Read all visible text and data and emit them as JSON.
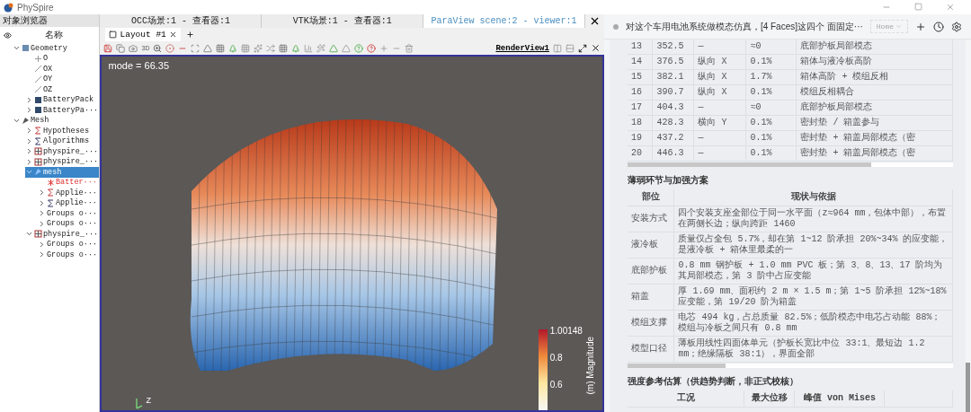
{
  "window": {
    "title": "PhySpire"
  },
  "browser": {
    "title": "对象浏览器",
    "column": "名称",
    "tree": [
      {
        "label": "Geometry",
        "kind": "geometry",
        "expanded": true,
        "selected": false,
        "children": [
          {
            "label": "O",
            "kind": "point",
            "selected": false
          },
          {
            "label": "OX",
            "kind": "axis",
            "selected": false
          },
          {
            "label": "OY",
            "kind": "axis",
            "selected": false
          },
          {
            "label": "OZ",
            "kind": "axis",
            "selected": false
          },
          {
            "label": "BatteryPack",
            "kind": "solid",
            "expanded": false,
            "selected": false
          },
          {
            "label": "BatteryPa···",
            "kind": "solid",
            "expanded": false,
            "selected": false
          }
        ]
      },
      {
        "label": "Mesh",
        "kind": "mesh",
        "expanded": true,
        "selected": false,
        "children": [
          {
            "label": "Hypotheses",
            "kind": "hypothesis",
            "expanded": false,
            "selected": false
          },
          {
            "label": "Algorithms",
            "kind": "algorithm",
            "expanded": false,
            "selected": false
          },
          {
            "label": "physpire_···",
            "kind": "mesh-object",
            "expanded": false,
            "selected": false
          },
          {
            "label": "physpire_···",
            "kind": "mesh-object",
            "expanded": false,
            "selected": false
          },
          {
            "label": "mesh",
            "kind": "submesh",
            "expanded": true,
            "selected": true,
            "children": [
              {
                "label": "Batter···",
                "kind": "error",
                "selected": false
              },
              {
                "label": "Applie···",
                "kind": "hypothesis",
                "expanded": false,
                "selected": false
              },
              {
                "label": "Applie···",
                "kind": "algorithm",
                "expanded": false,
                "selected": false
              },
              {
                "label": "Groups o···",
                "kind": "group",
                "expanded": false,
                "selected": false
              },
              {
                "label": "Groups o···",
                "kind": "group",
                "expanded": false,
                "selected": false
              }
            ]
          },
          {
            "label": "physpire_···",
            "kind": "mesh-object",
            "expanded": true,
            "selected": false,
            "children": [
              {
                "label": "Groups o···",
                "kind": "group",
                "expanded": false,
                "selected": false
              },
              {
                "label": "Groups o···",
                "kind": "group",
                "expanded": false,
                "selected": false
              }
            ]
          }
        ]
      }
    ]
  },
  "viewer_tabs": [
    {
      "label": "OCC场景:1 - 查看器:1",
      "selected": false
    },
    {
      "label": "VTK场景:1 - 查看器:1",
      "selected": false
    },
    {
      "label": "ParaView scene:2 - viewer:1",
      "selected": true
    }
  ],
  "layout_tabs": [
    {
      "label": "Layout #1",
      "selected": true
    }
  ],
  "toolbar": {
    "view_mode": "3D",
    "render_view": "RenderView1"
  },
  "viewport": {
    "mode_label": "mode = 66.35",
    "axis_label": "Z",
    "legend": {
      "title": "(m) Magnitude",
      "labels": [
        "1.00148",
        "0.8",
        "0.6"
      ]
    }
  },
  "chat": {
    "prompt": "对这个车用电池系统做模态仿真，[4 Faces]这四个 面固定···",
    "home_select": "Home"
  },
  "modes_table": {
    "rows": [
      [
        "13",
        "352.5",
        "—",
        "≈0",
        "底部护板局部模态"
      ],
      [
        "14",
        "376.5",
        "纵向 X",
        "0.1%",
        "箱体与液冷板高阶"
      ],
      [
        "15",
        "382.1",
        "纵向 X",
        "1.7%",
        "箱体高阶 + 模组反相"
      ],
      [
        "16",
        "390.7",
        "纵向 X",
        "0.1%",
        "模组反相耦合"
      ],
      [
        "17",
        "404.3",
        "—",
        "≈0",
        "底部护板局部模态"
      ],
      [
        "18",
        "428.3",
        "横向 Y",
        "0.1%",
        "密封垫 / 箱盖参与"
      ],
      [
        "19",
        "437.2",
        "—",
        "0.1%",
        "密封垫 + 箱盖局部模态（密"
      ],
      [
        "20",
        "446.3",
        "—",
        "0.1%",
        "密封垫 + 箱盖局部模态（密"
      ]
    ]
  },
  "weak_points": {
    "heading": "薄弱环节与加强方案",
    "columns": [
      "部位",
      "现状与依据"
    ],
    "rows": [
      [
        "安装方式",
        "四个安装支座全部位于同一水平面（z≈964 mm，包体中部），布置在两侧长边；纵向跨距 1460"
      ],
      [
        "液冷板",
        "质量仅占全包 5.7%，却在第 1~12 阶承担 20%~34% 的应变能，是液冷板 + 箱体里最柔的一"
      ],
      [
        "底部护板",
        "0.8 mm 钢护板 + 1.0 mm PVC 板；第 3、8、13、17 阶均为其局部模态，第 3 阶中占应变能"
      ],
      [
        "箱盖",
        "厚 1.69 mm、面积约 2 m × 1.5 m；第 1~5 阶承担 12%~18% 应变能，第 19/20 阶为箱盖"
      ],
      [
        "模组支撑",
        "电芯 494 kg，占总质量 82.5%；低阶模态中电芯占动能 88%；模组与冷板之间只有 0.8 mm"
      ],
      [
        "模型口径",
        "薄板用线性四面体单元（护板长宽比中位 33:1、最短边 1.2 mm；绝缘隔板 38:1），界面全部"
      ]
    ]
  },
  "strength": {
    "heading": "强度参考估算（供趋势判断，非正式校核）",
    "columns": [
      "工况",
      "最大位移",
      "峰值 von Mises"
    ]
  }
}
